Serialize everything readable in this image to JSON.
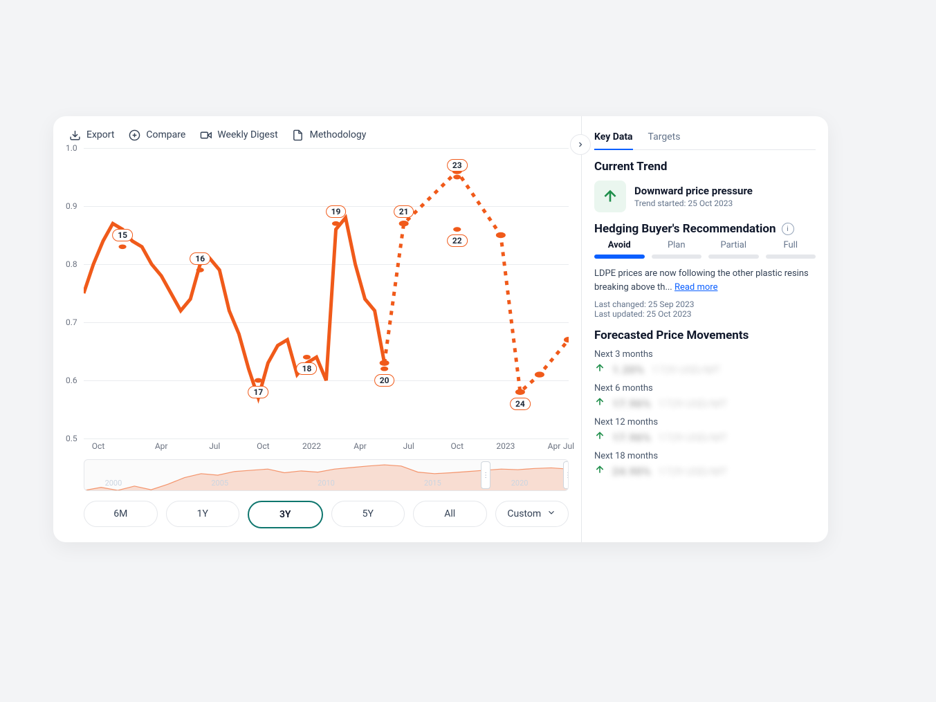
{
  "toolbar": {
    "export": "Export",
    "compare": "Compare",
    "digest": "Weekly Digest",
    "method": "Methodology"
  },
  "chart_data": {
    "type": "line",
    "title": "",
    "xlabel": "",
    "ylabel": "",
    "ylim": [
      0.5,
      1.0
    ],
    "y_ticks": [
      0.5,
      0.6,
      0.7,
      0.8,
      0.9,
      1.0
    ],
    "x_ticks": [
      "Oct",
      "Apr",
      "Jul",
      "Oct",
      "2022",
      "Apr",
      "Jul",
      "Oct",
      "2023",
      "Apr",
      "Jul"
    ],
    "x_tick_positions_pct": [
      3,
      16,
      27,
      37,
      47,
      57,
      67,
      77,
      87,
      97,
      100
    ],
    "series": [
      {
        "name": "historical",
        "style": "solid",
        "color": "#f05a1a",
        "x_pct": [
          0,
          2,
          4,
          6,
          8,
          10,
          12,
          14,
          16,
          18,
          20,
          22,
          24,
          26,
          28,
          30,
          32,
          34,
          36,
          38,
          40,
          42,
          44,
          46,
          48,
          50,
          52,
          54,
          56,
          58,
          60,
          62
        ],
        "values": [
          0.75,
          0.8,
          0.84,
          0.87,
          0.86,
          0.84,
          0.83,
          0.8,
          0.78,
          0.75,
          0.72,
          0.74,
          0.8,
          0.81,
          0.79,
          0.72,
          0.68,
          0.62,
          0.57,
          0.63,
          0.66,
          0.67,
          0.61,
          0.63,
          0.64,
          0.6,
          0.86,
          0.88,
          0.8,
          0.74,
          0.72,
          0.63
        ]
      },
      {
        "name": "forecast",
        "style": "dashed",
        "color": "#f05a1a",
        "x_pct": [
          62,
          66,
          77,
          86,
          90,
          94,
          100
        ],
        "values": [
          0.63,
          0.87,
          0.96,
          0.85,
          0.58,
          0.61,
          0.67
        ]
      }
    ],
    "annotations": [
      {
        "id": "15",
        "x_pct": 8,
        "y": 0.83
      },
      {
        "id": "16",
        "x_pct": 24,
        "y": 0.79
      },
      {
        "id": "17",
        "x_pct": 36,
        "y": 0.6
      },
      {
        "id": "18",
        "x_pct": 46,
        "y": 0.64
      },
      {
        "id": "19",
        "x_pct": 52,
        "y": 0.87
      },
      {
        "id": "20",
        "x_pct": 62,
        "y": 0.62
      },
      {
        "id": "21",
        "x_pct": 66,
        "y": 0.87
      },
      {
        "id": "22",
        "x_pct": 77,
        "y": 0.86
      },
      {
        "id": "23",
        "x_pct": 77,
        "y": 0.95
      },
      {
        "id": "24",
        "x_pct": 90,
        "y": 0.58
      }
    ],
    "brush_ticks": [
      "2000",
      "2005",
      "2010",
      "2015",
      "2020"
    ],
    "brush_tick_positions_pct": [
      6,
      28,
      50,
      72,
      90
    ],
    "brush_selection_pct": [
      82,
      99
    ]
  },
  "ranges": {
    "items": [
      "6M",
      "1Y",
      "3Y",
      "5Y",
      "All",
      "Custom"
    ],
    "active_index": 2
  },
  "side": {
    "tabs": {
      "items": [
        "Key Data",
        "Targets"
      ],
      "active_index": 0
    },
    "current_trend": {
      "heading": "Current Trend",
      "title": "Downward price pressure",
      "subtitle": "Trend started: 25 Oct 2023"
    },
    "hedge": {
      "heading": "Hedging Buyer's Recommendation",
      "options": [
        "Avoid",
        "Plan",
        "Partial",
        "Full"
      ],
      "active_index": 0,
      "desc_prefix": "LDPE prices are now following the other plastic resins breaking above th... ",
      "read_more": "Read more",
      "last_changed": "Last changed: 25 Sep 2023",
      "last_updated": "Last updated: 25 Oct 2023"
    },
    "forecast": {
      "heading": "Forecasted Price Movements",
      "rows": [
        {
          "label": "Next 3 months",
          "v1": "1.20%",
          "v2": "1729 USD/MT"
        },
        {
          "label": "Next 6 months",
          "v1": "17.96%",
          "v2": "1729 USD/MT"
        },
        {
          "label": "Next 12 months",
          "v1": "17.96%",
          "v2": "1729 USD/MT"
        },
        {
          "label": "Next 18 months",
          "v1": "24.90%",
          "v2": "1729 USD/MT"
        }
      ]
    }
  }
}
